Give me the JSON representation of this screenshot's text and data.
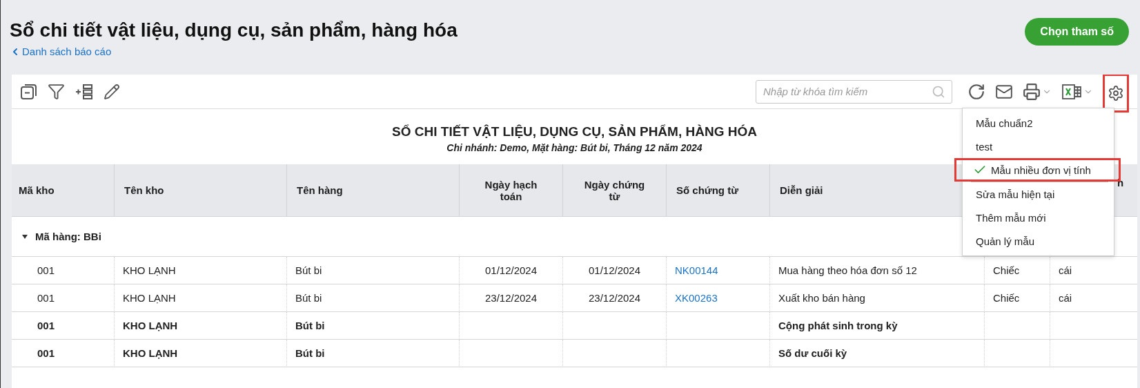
{
  "page": {
    "title": "Sổ chi tiết vật liệu, dụng cụ, sản phẩm, hàng hóa",
    "back_link": "Danh sách báo cáo",
    "action_button": "Chọn tham số"
  },
  "toolbar": {
    "search": {
      "placeholder": "Nhập từ khóa tìm kiếm"
    },
    "settings_highlighted": true
  },
  "report": {
    "title": "SỔ CHI TIẾT VẬT LIỆU, DỤNG CỤ, SẢN PHẨM, HÀNG HÓA",
    "subtitle": "Chi nhánh: Demo, Mặt hàng: Bút bi, Tháng 12 năm 2024"
  },
  "table": {
    "columns": [
      "Mã kho",
      "Tên kho",
      "Tên hàng",
      "Ngày hạch toán",
      "Ngày chứng từ",
      "Số chứng từ",
      "Diễn giải",
      null,
      "h"
    ],
    "group": {
      "label": "Mã hàng: BBi",
      "expanded": true
    },
    "rows": [
      {
        "kind": "entry",
        "cells": [
          "001",
          "KHO LẠNH",
          "Bút bi",
          "01/12/2024",
          "01/12/2024",
          "NK00144",
          "Mua hàng theo hóa đơn số 12",
          "Chiếc",
          "cái"
        ]
      },
      {
        "kind": "entry",
        "cells": [
          "001",
          "KHO LẠNH",
          "Bút bi",
          "23/12/2024",
          "23/12/2024",
          "XK00263",
          "Xuất kho bán hàng",
          "Chiếc",
          "cái"
        ]
      },
      {
        "kind": "total",
        "cells": [
          "001",
          "KHO LẠNH",
          "Bút bi",
          null,
          null,
          null,
          "Cộng phát sinh trong kỳ",
          null,
          null
        ]
      },
      {
        "kind": "total",
        "cells": [
          "001",
          "KHO LẠNH",
          "Bút bi",
          null,
          null,
          null,
          "Số dư cuối kỳ",
          null,
          null
        ]
      }
    ]
  },
  "menu": {
    "items": [
      {
        "kind": "template",
        "label": "Mẫu chuẩn2",
        "checked": false,
        "highlighted": false
      },
      {
        "kind": "template",
        "label": "test",
        "checked": false,
        "highlighted": false
      },
      {
        "kind": "template",
        "label": "Mẫu nhiều đơn vị tính",
        "checked": true,
        "highlighted": true
      },
      {
        "kind": "action",
        "label": "Sửa mẫu hiện tại",
        "checked": false,
        "highlighted": false
      },
      {
        "kind": "action",
        "label": "Thêm mẫu mới",
        "checked": false,
        "highlighted": false
      },
      {
        "kind": "action",
        "label": "Quản lý mẫu",
        "checked": false,
        "highlighted": false
      }
    ]
  }
}
